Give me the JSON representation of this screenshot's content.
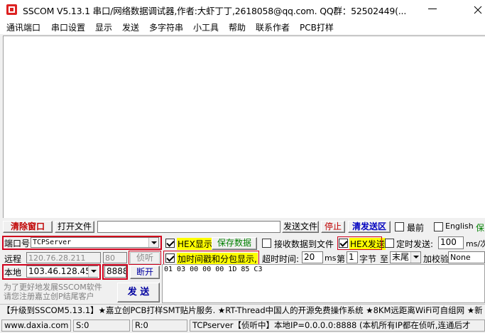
{
  "window": {
    "title": "SSCOM V5.13.1 串口/网络数据调试器,作者:大虾丁丁,2618058@qq.com. QQ群：52502449(..."
  },
  "menu": [
    "通讯端口",
    "串口设置",
    "显示",
    "发送",
    "多字符串",
    "小工具",
    "帮助",
    "联系作者",
    "PCB打样"
  ],
  "toolbar": {
    "clear_window": "清除窗口",
    "open_file": "打开文件",
    "file_path": "",
    "send_file": "发送文件",
    "stop": "停止",
    "clear_send": "清发送区",
    "last_label": "最前",
    "english_label": "English",
    "save_cut": "保"
  },
  "port": {
    "label": "端口号",
    "value": "TCPServer",
    "remote_label": "远程",
    "remote_ip": "120.76.28.211",
    "remote_port": "80",
    "listen": "侦听",
    "local_label": "本地",
    "local_ip": "103.46.128.45",
    "local_port": "8888",
    "disconnect": "断开"
  },
  "options": {
    "hex_display": "HEX显示",
    "save_data": "保存数据",
    "recv_to_file": "接收数据到文件",
    "hex_send": "HEX发送",
    "timed_send": "定时发送:",
    "interval": "100",
    "interval_unit": "ms/次",
    "timestamp": "加时间戳和分包显示,",
    "timeout_label": "超时时间:",
    "timeout_value": "20",
    "timeout_unit": "ms",
    "byte_no_label": "第",
    "byte_no": "1",
    "byte_label": "字节",
    "to_label": "至",
    "end_value": "末尾",
    "checksum_label": "加校验",
    "checksum_value": "None"
  },
  "send": {
    "payload": "01 03 00 00 00 1D 85 C3",
    "button": "发 送",
    "promo": "为了更好地发展SSCOM软件\n请您注册嘉立创P结尾客户"
  },
  "ad_text": "【升级到SSCOM5.13.1】★嘉立创PCB打样SMT贴片服务. ★RT-Thread中国人的开源免费操作系统 ★8KM远距离WiFi可自组网 ★新",
  "status": {
    "site": "www.daxia.com",
    "sent": "S:0",
    "received": "R:0",
    "info": "TCPserver【侦听中】本地IP=0.0.0.0:8888 (本机所有IP都在侦听,连通后才"
  },
  "colors": {
    "red_box": "#d0001c",
    "highlight": "#ffff00",
    "clear_window_text": "#c00000",
    "clear_send_text": "#0000c0"
  }
}
